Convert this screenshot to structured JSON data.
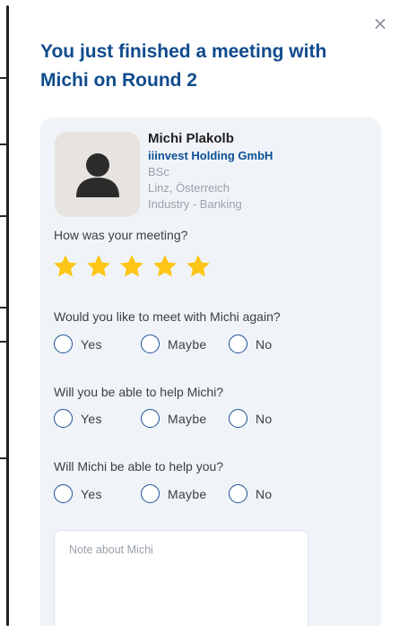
{
  "dialog": {
    "title": "You just finished a meeting with Michi on Round 2",
    "close_icon": "×"
  },
  "person": {
    "name": "Michi Plakolb",
    "company": "iiinvest Holding GmbH",
    "degree": "BSc",
    "location": "Linz, Österreich",
    "industry": "Industry - Banking"
  },
  "rating": {
    "question": "How was your meeting?",
    "value": 5,
    "max": 5,
    "star_color": "#fdc516"
  },
  "questions": [
    {
      "label": "Would you like to meet with Michi again?",
      "options": [
        "Yes",
        "Maybe",
        "No"
      ]
    },
    {
      "label": "Will you be able to help Michi?",
      "options": [
        "Yes",
        "Maybe",
        "No"
      ]
    },
    {
      "label": "Will Michi be able to help you?",
      "options": [
        "Yes",
        "Maybe",
        "No"
      ]
    }
  ],
  "note": {
    "placeholder": "Note about Michi",
    "value": ""
  },
  "colors": {
    "title": "#0f4b8d",
    "company": "#0d4f96",
    "card_background": "#f0f4f9",
    "radio_border": "#1d4f93"
  }
}
